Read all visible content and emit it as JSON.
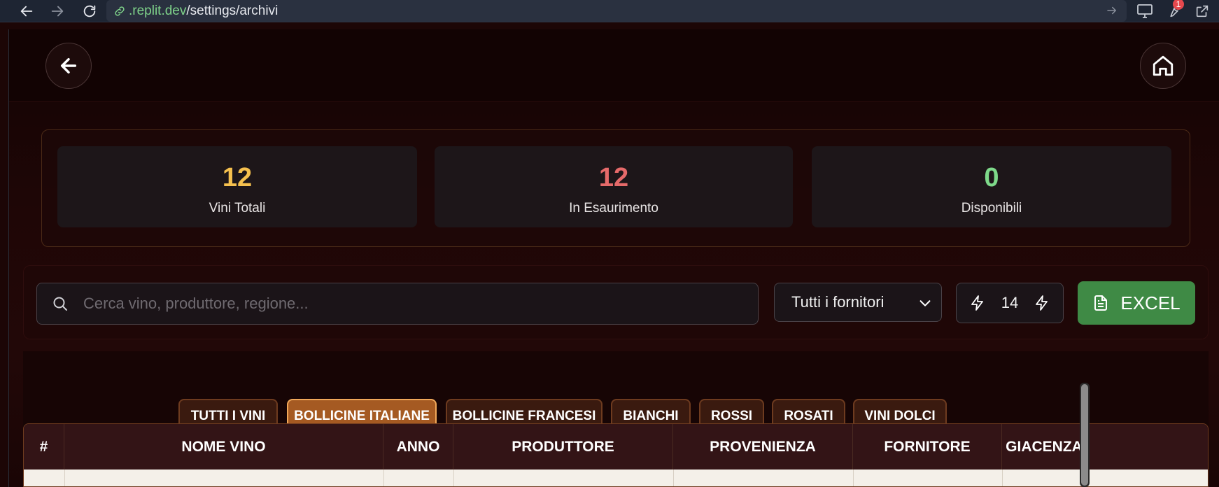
{
  "browser": {
    "url_host": ".replit.dev",
    "url_path": "/settings/archivi",
    "notification_count": "1"
  },
  "stats": [
    {
      "value": "12",
      "label": "Vini Totali",
      "color": "#f5c04e"
    },
    {
      "value": "12",
      "label": "In Esaurimento",
      "color": "#e66a6a"
    },
    {
      "value": "0",
      "label": "Disponibili",
      "color": "#7ed98a"
    }
  ],
  "search": {
    "placeholder": "Cerca vino, produttore, regione...",
    "value": ""
  },
  "supplier_filter": {
    "selected": "Tutti i fornitori"
  },
  "stepper": {
    "value": "14"
  },
  "excel_button": {
    "label": "EXCEL"
  },
  "categories": [
    {
      "label": "TUTTI I VINI",
      "active": false
    },
    {
      "label": "BOLLICINE ITALIANE",
      "active": true
    },
    {
      "label": "BOLLICINE FRANCESI",
      "active": false
    },
    {
      "label": "BIANCHI",
      "active": false
    },
    {
      "label": "ROSSI",
      "active": false
    },
    {
      "label": "ROSATI",
      "active": false
    },
    {
      "label": "VINI DOLCI",
      "active": false
    }
  ],
  "table": {
    "columns": [
      "#",
      "NOME VINO",
      "ANNO",
      "PRODUTTORE",
      "PROVENIENZA",
      "FORNITORE",
      "GIACENZA"
    ]
  },
  "colors": {
    "accent_active": "#a55a22",
    "excel_green": "#3f8a45",
    "background": "#1c0606"
  }
}
